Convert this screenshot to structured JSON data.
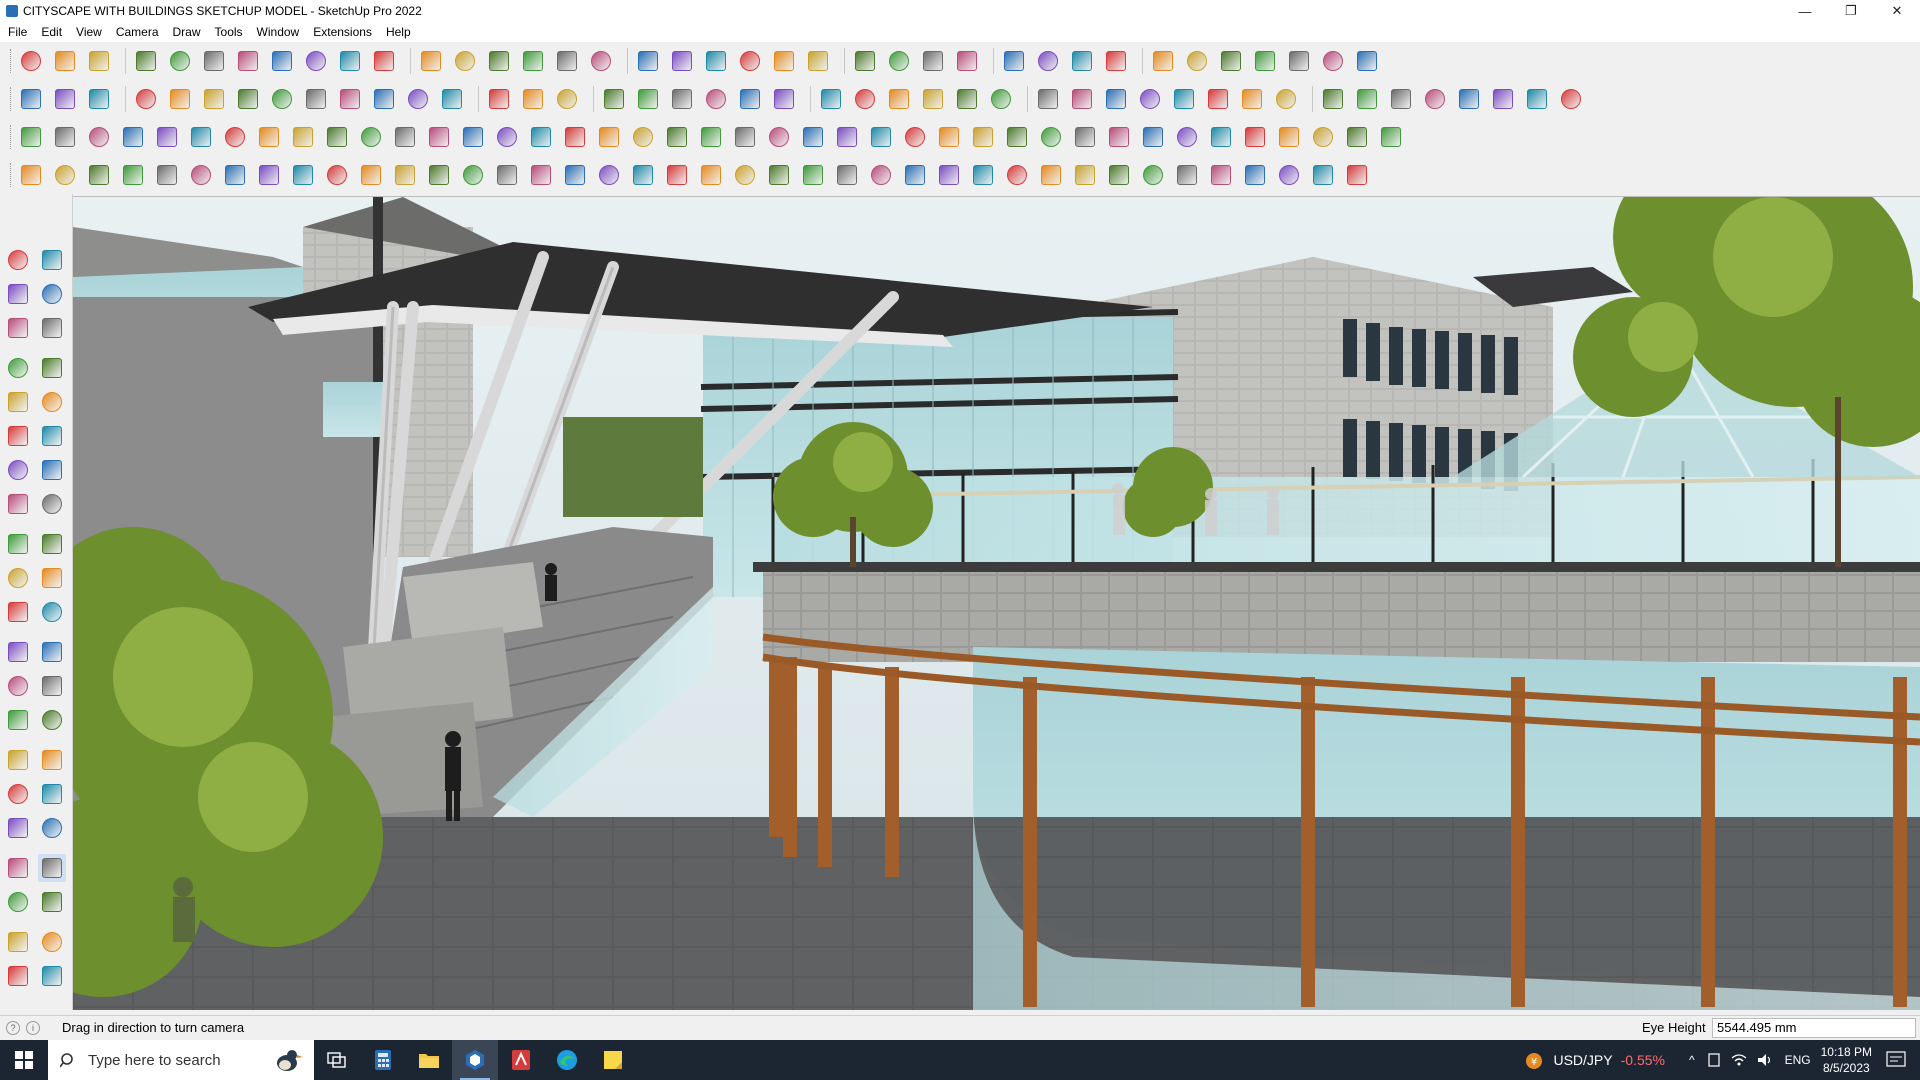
{
  "window": {
    "title": "CITYSCAPE WITH BUILDINGS SKETCHUP MODEL - SketchUp Pro 2022",
    "controls": [
      "—",
      "❐",
      "✕"
    ]
  },
  "menu": [
    "File",
    "Edit",
    "View",
    "Camera",
    "Draw",
    "Tools",
    "Window",
    "Extensions",
    "Help"
  ],
  "status": {
    "hint": "Drag in direction to turn camera",
    "eye_height_label": "Eye Height",
    "eye_height_value": "5544.495 mm"
  },
  "taskbar": {
    "search_placeholder": "Type here to search",
    "ticker_symbol": "USD/JPY",
    "ticker_change": "-0.55%",
    "language": "ENG",
    "time": "10:18 PM",
    "date": "8/5/2023"
  },
  "colors": {
    "accent_red": "#d63b3b",
    "accent_blue": "#2a6fb5",
    "accent_green": "#3f9a3a",
    "accent_orange": "#e58a1f",
    "ticker_negative": "#ff6b6b"
  }
}
